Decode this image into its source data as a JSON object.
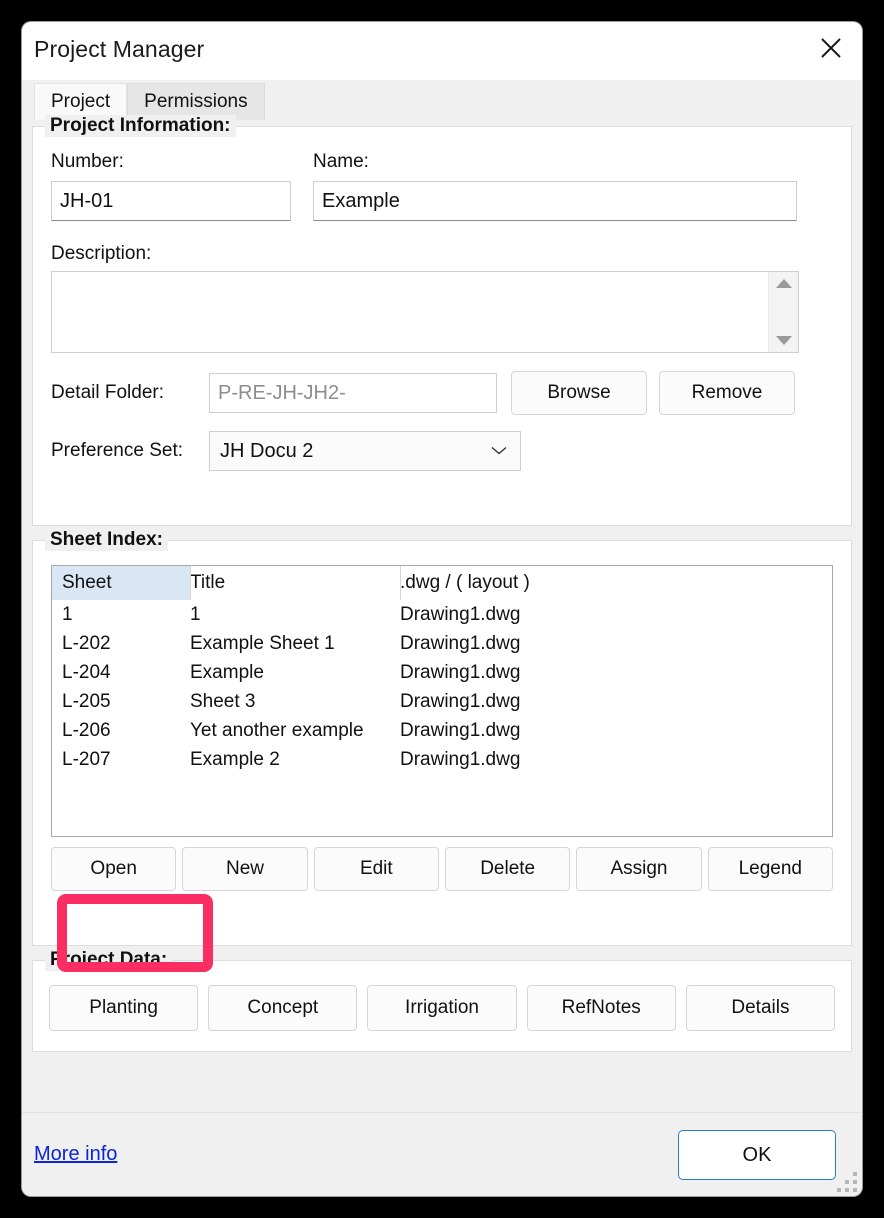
{
  "window": {
    "title": "Project Manager",
    "close_icon": "close-icon"
  },
  "tabs": [
    {
      "label": "Project",
      "active": true
    },
    {
      "label": "Permissions",
      "active": false
    }
  ],
  "project_information": {
    "group_label": "Project Information:",
    "number_label": "Number:",
    "number_value": "JH-01",
    "name_label": "Name:",
    "name_value": "Example",
    "description_label": "Description:",
    "description_value": "",
    "scroll_up_icon": "triangle-up-icon",
    "scroll_down_icon": "triangle-down-icon",
    "detail_folder_label": "Detail Folder:",
    "detail_folder_value": "P-RE-JH-JH2-",
    "browse_label": "Browse",
    "remove_label": "Remove",
    "preference_set_label": "Preference Set:",
    "preference_set_value": "JH Docu 2",
    "preference_set_chevron": "chevron-down-icon"
  },
  "sheet_index": {
    "group_label": "Sheet Index:",
    "columns": [
      "Sheet",
      "Title",
      ".dwg / ( layout )"
    ],
    "rows": [
      {
        "sheet": "1",
        "title": "1",
        "dwg": "Drawing1.dwg"
      },
      {
        "sheet": "L-202",
        "title": "Example Sheet 1",
        "dwg": "Drawing1.dwg"
      },
      {
        "sheet": "L-204",
        "title": "Example",
        "dwg": "Drawing1.dwg"
      },
      {
        "sheet": "L-205",
        "title": "Sheet 3",
        "dwg": "Drawing1.dwg"
      },
      {
        "sheet": "L-206",
        "title": "Yet another example",
        "dwg": "Drawing1.dwg"
      },
      {
        "sheet": "L-207",
        "title": "Example 2",
        "dwg": "Drawing1.dwg"
      }
    ],
    "buttons": [
      "Open",
      "New",
      "Edit",
      "Delete",
      "Assign",
      "Legend"
    ]
  },
  "project_data": {
    "group_label": "Project Data:",
    "buttons": [
      "Planting",
      "Concept",
      "Irrigation",
      "RefNotes",
      "Details"
    ]
  },
  "footer": {
    "more_info": "More info",
    "ok_label": "OK",
    "grip_icon": "resize-grip-icon"
  },
  "highlight": {
    "target": "Open",
    "color": "#fa2e63"
  },
  "colors": {
    "accent_link": "#0b24d6",
    "default_button_border": "#2a7ec4",
    "header_cell_highlight": "#d9e7f5",
    "highlight_box": "#fa2e63"
  }
}
